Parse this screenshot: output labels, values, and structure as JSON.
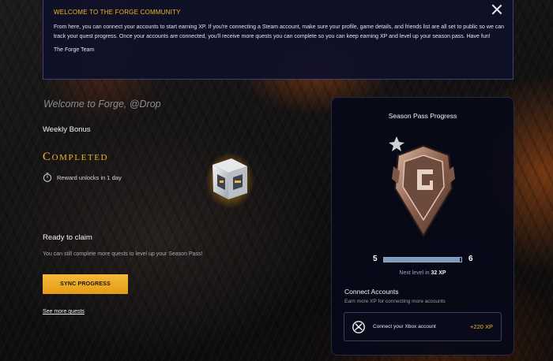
{
  "banner": {
    "title": "WELCOME TO THE FORGE COMMUNITY",
    "body": "From here, you can connect your accounts to start earning XP. If you're connecting a Steam account, make sure your profile, game details, and friends list are all set to public so we can track your quest progress. Once your accounts are connected, you'll receive more quests you can complete so you can keep earning XP and level up your season pass. Have fun!",
    "signature": "The Forge Team",
    "close_icon": "close-icon"
  },
  "main": {
    "welcome": "Welcome to Forge, @Drop",
    "weekly_bonus": "Weekly Bonus",
    "status": "Completed",
    "timer_text": "Reward unlocks in 1 day",
    "ready_title": "Ready to claim",
    "ready_subtitle": "You can still complete more quests to level up your Season Pass!",
    "sync_button": "SYNC PROGRESS",
    "more_link": "See more quests"
  },
  "season": {
    "title": "Season Pass Progress",
    "current_level": "5",
    "next_level": "6",
    "progress": 0.98,
    "next_level_text": "Next level in",
    "next_level_xp": "32 XP",
    "connect_title": "Connect Accounts",
    "connect_subtitle": "Earn more XP for connecting more accounts",
    "xbox_label": "Connect your Xbox account",
    "xbox_xp": "+220 XP"
  },
  "colors": {
    "accent": "#f0b429",
    "banner_bg": "#0e1028",
    "card_bg": "#070918",
    "progress_fill": "#7f9bbb"
  }
}
